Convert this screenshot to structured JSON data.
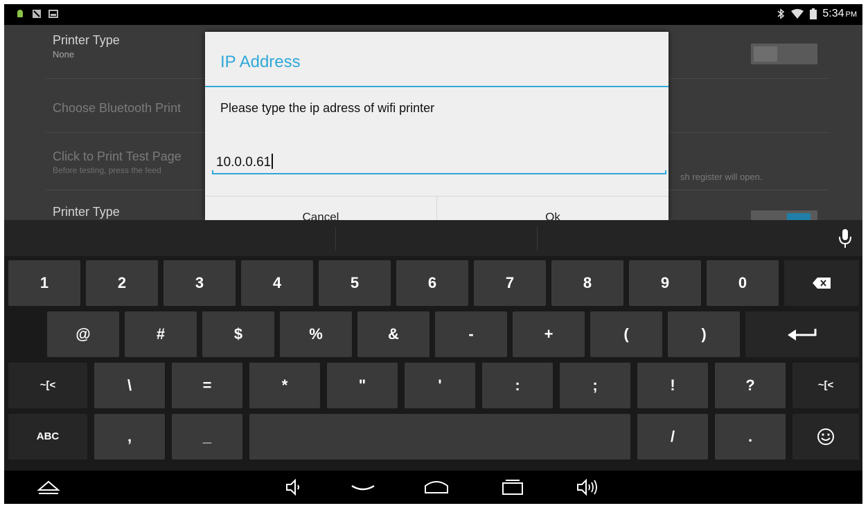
{
  "status_bar": {
    "time": "5:34",
    "ampm": "PM",
    "left_icons": [
      "android-icon",
      "notification-icon",
      "image-icon"
    ],
    "right_icons": [
      "bluetooth-icon",
      "wifi-icon",
      "battery-icon"
    ]
  },
  "settings": {
    "rows": [
      {
        "title": "Printer Type",
        "subtitle": "None"
      },
      {
        "title": "Choose Bluetooth Print"
      },
      {
        "title": "Click to Print Test Page",
        "subtitle": "Before testing, press the feed"
      },
      {
        "title": "Printer Type"
      }
    ],
    "register_note": "sh register will open."
  },
  "dialog": {
    "title": "IP Address",
    "message": "Please type the ip adress of wifi printer",
    "input_value": "10.0.0.61",
    "cancel_label": "Cancel",
    "ok_label": "Ok"
  },
  "keyboard": {
    "row1": [
      "1",
      "2",
      "3",
      "4",
      "5",
      "6",
      "7",
      "8",
      "9",
      "0"
    ],
    "row2": [
      "@",
      "#",
      "$",
      "%",
      "&",
      "-",
      "+",
      "(",
      ")"
    ],
    "row3": [
      "\\",
      "=",
      "*",
      "\"",
      "'",
      ":",
      ";",
      "!",
      "?"
    ],
    "row3_left": "~[<",
    "row3_right": "~[<",
    "row4_left": "ABC",
    "row4": [
      ",",
      "_"
    ],
    "row4_right": [
      "/",
      "."
    ]
  },
  "colors": {
    "accent": "#2fa8d8",
    "dialog_bg": "#efefef",
    "key_bg": "#3a3a3a",
    "keyboard_bg": "#1a1a1a"
  }
}
